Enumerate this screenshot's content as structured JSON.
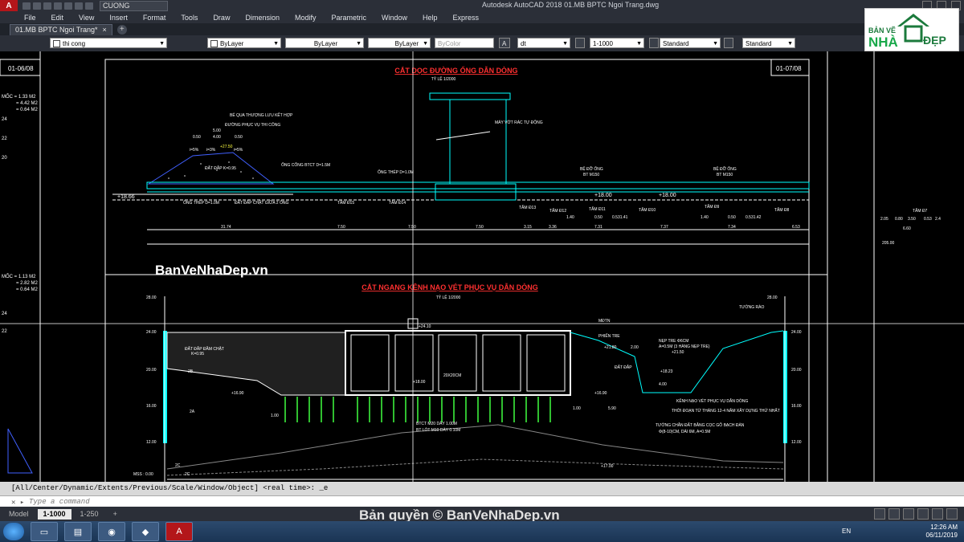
{
  "window": {
    "title": "Autodesk AutoCAD 2018    01.MB BPTC Ngoi Trang.dwg",
    "workspace": "CUONG",
    "app_icon": "A"
  },
  "menu": [
    "File",
    "Edit",
    "View",
    "Insert",
    "Format",
    "Tools",
    "Draw",
    "Dimension",
    "Modify",
    "Parametric",
    "Window",
    "Help",
    "Express"
  ],
  "doc_tab": {
    "label": "01.MB BPTC Ngoi Trang*",
    "close": "×",
    "new": "+"
  },
  "toolbar": {
    "layer": "thi cong",
    "color": "ByLayer",
    "linetype": "ByLayer",
    "lineweight": "ByLayer",
    "plotstyle": "ByColor",
    "textstyle": "dt",
    "scale": "1-1000",
    "dimstyle": "Standard",
    "mleaderstyle": "Standard"
  },
  "logo": {
    "line1": "BẢN VẼ",
    "line2": "NHÀ",
    "line3": "ĐẸP"
  },
  "drawing": {
    "title1": "CẮT DỌC ĐƯỜNG ỐNG DẪN DÒNG",
    "scale1": "TỶ LỆ 1/2000",
    "sheet_left": "01-06/08",
    "sheet_right": "01-07/08",
    "title2": "CẮT NGANG KÊNH NẠO VÉT PHỤC VỤ DẪN DÒNG",
    "scale2": "TỶ LỆ 1/2000",
    "watermark": "BanVeNhaDep.vn",
    "left_notes_a": [
      "MỐC = 1.33 M2",
      "= 4.42 M2",
      "= 0.64 M2"
    ],
    "left_notes_b": [
      "MỐC = 1.13 M2",
      "= 2.82 M2",
      "= 0.64 M2"
    ],
    "left_ticks": [
      "24",
      "22",
      "20",
      "24",
      "22"
    ],
    "labels_top": [
      "BỂ QUA THƯỢNG LƯU KẾT HỢP",
      "ĐƯỜNG PHỤC VỤ THI CÔNG",
      "5.00",
      "0.50",
      "4.00",
      "0.50",
      "i=5%",
      "i=3%",
      "i=5%",
      "+27.50",
      "ĐẤT ĐẮP K=0.95",
      "ỐNG CỐNG BTCT D=1.5M",
      "ỐNG THÉP D=1.0M",
      "MÁY VỚT RÁC TỰ ĐỘNG",
      "BỆ ĐỠ ỐNG",
      "BT M150",
      "BỆ ĐỠ ỐNG",
      "BT M150",
      "+18.66",
      "ỐNG THÉP D=1.0M",
      "ĐẤT ĐẮP CHẶT GIỮA 2 ỐNG",
      "TẤM Đ15",
      "TẤM Đ14",
      "TẤM Đ13",
      "TẤM Đ12",
      "TẤM Đ11",
      "TẤM Đ10",
      "TẤM Đ9",
      "TẤM Đ8",
      "+18.00",
      "+18.00",
      "1.40",
      "0.50",
      "0.531.41",
      "1.40",
      "0.50",
      "0.531.42",
      "TẤM Đ7",
      "2.05",
      "0.80",
      "3.50",
      "0.53",
      "2.4",
      "6.60",
      "205.00"
    ],
    "dims_top": [
      "31.74",
      "7.50",
      "7.50",
      "7.50",
      "3.15",
      "3.36",
      "7.31",
      "7.37",
      "7.34",
      "6.53"
    ],
    "labels_bottom": [
      "ĐẤT ĐẮP ĐẦM CHẶT",
      "K=0.95",
      "+24.10",
      "MĐTN",
      "PHIẾN TRE",
      "+21.80",
      "2.00",
      "NẸP TRE Φ6CM",
      "A=0.5M (3 HÀNG NẸP TRE)",
      "+21.50",
      "ĐẤT ĐẮP",
      "+18.23",
      "+18.00",
      "+16.90",
      "+16.90",
      "20X20CM",
      "1.00",
      "1.00",
      "5.90",
      "4.00",
      "KÊNH NẠO VÉT PHỤC VỤ DẪN DÒNG",
      "THỜI ĐOẠN TỪ THÁNG 12-4 NĂM XÂY DỰNG THỨ NHẤT",
      "TƯỜNG CHẮN ĐẤT BẰNG CỌC GỖ BẠCH ĐÀN",
      "Φ(8-10)CM, DÀI 6M, A=0.5M",
      "BTCT M20 DÀY 1.00M",
      "BT LÓT M10 DÀY 0.10M",
      "TƯỜNG RÀO",
      "+17.00",
      "MSS : 0.00",
      "2B",
      "2A",
      "2C",
      "2C"
    ],
    "ticks_bottom": [
      "28.00",
      "24.00",
      "20.00",
      "16.00",
      "12.00",
      "28.00",
      "24.00",
      "20.00",
      "16.00",
      "12.00"
    ],
    "box_count": 5
  },
  "command": {
    "history": "[All/Center/Dynamic/Extents/Previous/Scale/Window/Object] <real time>: _e",
    "prompt": "Type a command"
  },
  "layout_tabs": [
    "Model",
    "1-1000",
    "1-250",
    "+"
  ],
  "active_layout": "1-1000",
  "copyright": "Bản quyền © BanVeNhaDep.vn",
  "tray": {
    "lang": "EN",
    "time": "12:26 AM",
    "date": "06/11/2019"
  },
  "colors": {
    "cyan": "#00ffff",
    "red": "#ff3030",
    "yellow": "#ffff40",
    "green": "#40ff40",
    "white": "#ffffff",
    "magenta": "#ff40ff",
    "blue": "#4060ff"
  }
}
